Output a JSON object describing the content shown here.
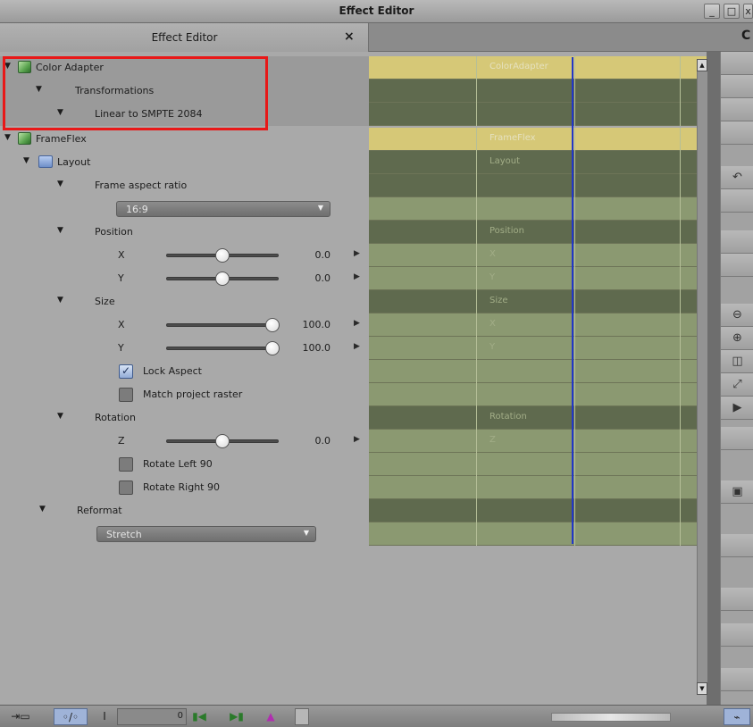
{
  "window": {
    "title": "Effect Editor",
    "controls": [
      "_",
      "□",
      "x"
    ]
  },
  "tab": {
    "label": "Effect Editor",
    "close": "×",
    "corner": "C"
  },
  "params": {
    "color_adapter": "Color Adapter",
    "transformations": "Transformations",
    "linear_to_smpte": "Linear to SMPTE 2084",
    "frameflex": "FrameFlex",
    "layout": "Layout",
    "frame_aspect_ratio": "Frame aspect ratio",
    "aspect_value": "16:9",
    "position": "Position",
    "position_x_label": "X",
    "position_x_value": "0.0",
    "position_y_label": "Y",
    "position_y_value": "0.0",
    "size": "Size",
    "size_x_label": "X",
    "size_x_value": "100.0",
    "size_y_label": "Y",
    "size_y_value": "100.0",
    "lock_aspect": "Lock Aspect",
    "match_project_raster": "Match project raster",
    "rotation": "Rotation",
    "rotation_z_label": "Z",
    "rotation_z_value": "0.0",
    "rotate_left": "Rotate Left 90",
    "rotate_right": "Rotate Right 90",
    "reformat": "Reformat",
    "reformat_value": "Stretch"
  },
  "controls_state": {
    "position_x_slider": 0.5,
    "position_y_slider": 0.5,
    "size_x_slider": 1.0,
    "size_y_slider": 1.0,
    "rotation_z_slider": 0.5,
    "lock_aspect_checked": true,
    "match_project_raster_checked": false,
    "rotate_left_checked": false,
    "rotate_right_checked": false
  },
  "timeline": {
    "color_adapter": "ColorAdapter",
    "frameflex": "FrameFlex",
    "layout": "Layout",
    "position": "Position",
    "pos_x": "X",
    "pos_y": "Y",
    "size": "Size",
    "size_x": "X",
    "size_y": "Y",
    "rotation": "Rotation",
    "rot_z": "Z"
  },
  "bottom": {
    "timecode": "0"
  },
  "colors": {
    "highlight": "#e81818",
    "playhead": "#2237c9",
    "keyframe_gold": "#d6c877"
  }
}
